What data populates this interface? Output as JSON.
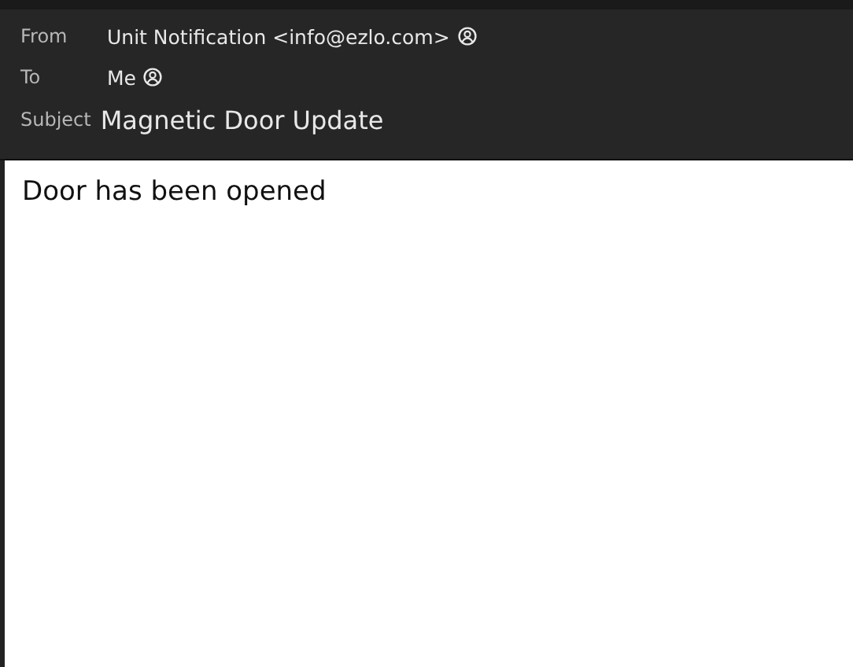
{
  "header": {
    "fields": [
      {
        "label": "From",
        "value": "Unit Notification <info@ezlo.com>",
        "kind": "address"
      },
      {
        "label": "To",
        "value": "Me",
        "kind": "address"
      },
      {
        "label": "Subject",
        "value": "Magnetic Door Update",
        "kind": "subject"
      }
    ]
  },
  "body": {
    "text": "Door has been opened"
  }
}
